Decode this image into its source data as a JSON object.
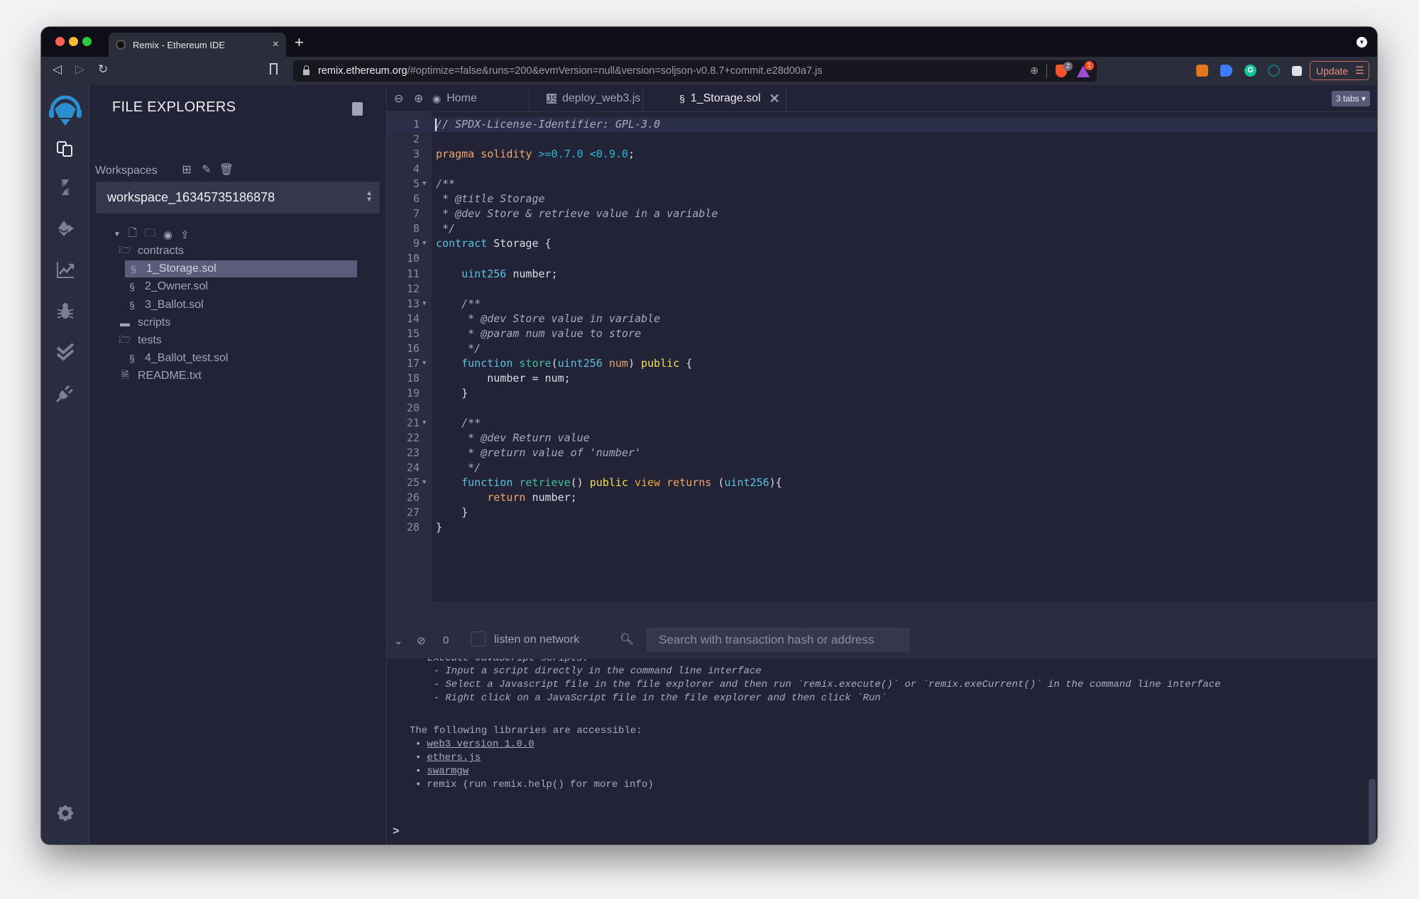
{
  "browser": {
    "tab_title": "Remix - Ethereum IDE",
    "tab_close": "×",
    "new_tab": "+",
    "url_host": "remix.ethereum.org",
    "url_rest": "/#optimize=false&runs=200&evmVersion=null&version=soljson-v0.8.7+commit.e28d00a7.js",
    "brave_shields_count": "2",
    "rewards_count": "1",
    "grammarly_letter": "G",
    "update_label": "Update",
    "menu_glyph": "☰",
    "back_glyph": "◁",
    "forward_glyph": "▷",
    "reload_glyph": "↻",
    "zoom_glyph": "⊕"
  },
  "icon_panel": {
    "items": [
      {
        "name": "file-explorers",
        "active": true
      },
      {
        "name": "solidity-compiler"
      },
      {
        "name": "deploy-run"
      },
      {
        "name": "analysis"
      },
      {
        "name": "debugger"
      },
      {
        "name": "unit-testing"
      },
      {
        "name": "plugin-manager"
      }
    ],
    "settings": "settings"
  },
  "sidebar": {
    "title": "FILE EXPLORERS",
    "workspaces_label": "Workspaces",
    "workspace_selected": "workspace_16345735186878",
    "tree": [
      {
        "type": "folder-open",
        "label": "contracts",
        "depth": 0
      },
      {
        "type": "sol",
        "label": "1_Storage.sol",
        "depth": 1,
        "selected": true
      },
      {
        "type": "sol",
        "label": "2_Owner.sol",
        "depth": 1
      },
      {
        "type": "sol",
        "label": "3_Ballot.sol",
        "depth": 1
      },
      {
        "type": "folder",
        "label": "scripts",
        "depth": 0
      },
      {
        "type": "folder-open",
        "label": "tests",
        "depth": 0
      },
      {
        "type": "sol",
        "label": "4_Ballot_test.sol",
        "depth": 1
      },
      {
        "type": "file",
        "label": "README.txt",
        "depth": 0
      }
    ]
  },
  "editor": {
    "tabs": [
      {
        "label": "Home",
        "icon": "remix-icon"
      },
      {
        "label": "deploy_web3.js",
        "icon": "js-icon"
      },
      {
        "label": "1_Storage.sol",
        "icon": "solidity-icon",
        "active": true
      }
    ],
    "tabs_dropdown": "3 tabs ▾",
    "current_line": 1,
    "fold_lines": [
      5,
      9,
      13,
      17,
      21,
      25
    ],
    "lines": [
      [
        [
          "com",
          "// SPDX-License-Identifier: GPL-3.0"
        ]
      ],
      [],
      [
        [
          "kw",
          "pragma solidity "
        ],
        [
          "cyan",
          ">=0.7.0 <0.9.0"
        ],
        [
          "plain",
          ";"
        ]
      ],
      [],
      [
        [
          "com",
          "/**"
        ]
      ],
      [
        [
          "com",
          " * @title Storage"
        ]
      ],
      [
        [
          "com",
          " * @dev Store & retrieve value in a variable"
        ]
      ],
      [
        [
          "com",
          " */"
        ]
      ],
      [
        [
          "type",
          "contract"
        ],
        [
          "plain",
          " Storage {"
        ]
      ],
      [],
      [
        [
          "plain",
          "    "
        ],
        [
          "type",
          "uint256"
        ],
        [
          "plain",
          " number;"
        ]
      ],
      [],
      [
        [
          "com",
          "    /**"
        ]
      ],
      [
        [
          "com",
          "     * @dev Store value in variable"
        ]
      ],
      [
        [
          "com",
          "     * @param num value to store"
        ]
      ],
      [
        [
          "com",
          "     */"
        ]
      ],
      [
        [
          "plain",
          "    "
        ],
        [
          "type",
          "function"
        ],
        [
          "plain",
          " "
        ],
        [
          "fn",
          "store"
        ],
        [
          "plain",
          "("
        ],
        [
          "type",
          "uint256"
        ],
        [
          "plain",
          " "
        ],
        [
          "param",
          "num"
        ],
        [
          "plain",
          ") "
        ],
        [
          "yel",
          "public"
        ],
        [
          "plain",
          " {"
        ]
      ],
      [
        [
          "plain",
          "        number = num;"
        ]
      ],
      [
        [
          "plain",
          "    }"
        ]
      ],
      [],
      [
        [
          "com",
          "    /**"
        ]
      ],
      [
        [
          "com",
          "     * @dev Return value"
        ]
      ],
      [
        [
          "com",
          "     * @return value of 'number'"
        ]
      ],
      [
        [
          "com",
          "     */"
        ]
      ],
      [
        [
          "plain",
          "    "
        ],
        [
          "type",
          "function"
        ],
        [
          "plain",
          " "
        ],
        [
          "fn",
          "retrieve"
        ],
        [
          "plain",
          "() "
        ],
        [
          "yel",
          "public"
        ],
        [
          "plain",
          " "
        ],
        [
          "gold",
          "view"
        ],
        [
          "plain",
          " "
        ],
        [
          "kw",
          "returns"
        ],
        [
          "plain",
          " ("
        ],
        [
          "type",
          "uint256"
        ],
        [
          "plain",
          "){"
        ]
      ],
      [
        [
          "plain",
          "        "
        ],
        [
          "kw",
          "return"
        ],
        [
          "plain",
          " number;"
        ]
      ],
      [
        [
          "plain",
          "    }"
        ]
      ],
      [
        [
          "plain",
          "}"
        ]
      ]
    ]
  },
  "terminal": {
    "pending_count": "0",
    "listen_label": "listen on network",
    "search_placeholder": "Search with transaction hash or address",
    "partial_header": " - Execute JavaScript scripts:",
    "script_lines": [
      "    - Input a script directly in the command line interface",
      "    - Select a Javascript file in the file explorer and then run `remix.execute()` or `remix.exeCurrent()` in the command line interface",
      "    - Right click on a JavaScript file in the file explorer and then click `Run`"
    ],
    "libraries_header": "The following libraries are accessible:",
    "libraries": [
      {
        "label": "web3 version 1.0.0",
        "link": true
      },
      {
        "label": "ethers.js",
        "link": true
      },
      {
        "label": "swarmgw",
        "link": true
      },
      {
        "label": "remix (run remix.help() for more info)",
        "link": false
      }
    ],
    "bullet": "•",
    "prompt": ">"
  }
}
